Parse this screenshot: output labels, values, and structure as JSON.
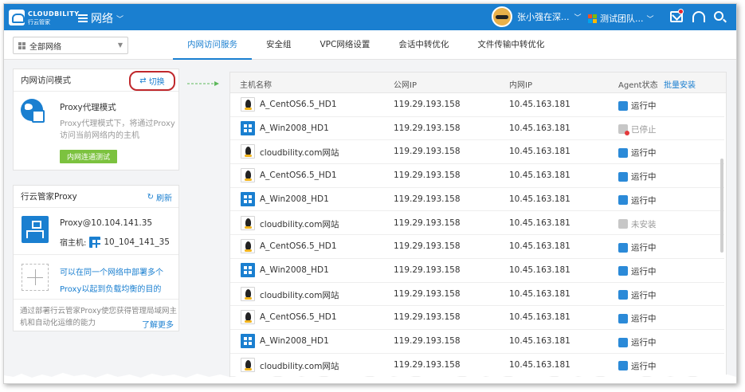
{
  "topbar": {
    "logo_text": "CLOUDBILITY",
    "logo_sub": "行云管家",
    "menu_title": "网络",
    "user_name": "张小强在深...",
    "team_name": "测试团队..."
  },
  "subnav": {
    "network_select": "全部网络",
    "tabs": [
      "内网访问服务",
      "安全组",
      "VPC网络设置",
      "会话中转优化",
      "文件传输中转优化"
    ]
  },
  "mode_panel": {
    "header": "内网访问模式",
    "switch_label": "切换",
    "mode_title": "Proxy代理模式",
    "mode_desc": "Proxy代理模式下，将通过Proxy访问当前网络内的主机",
    "test_button": "内网连通测试"
  },
  "proxy_panel": {
    "header": "行云管家Proxy",
    "refresh_label": "刷新",
    "proxy_name": "Proxy@10.104.141.35",
    "host_label": "宿主机:",
    "host_value": "10_104_141_35",
    "add_text": "可以在同一个网络中部署多个Proxy以起到负载均衡的目的",
    "footer_text": "通过部署行云管家Proxy使您获得管理局域网主机和自动化运维的能力",
    "learn_more": "了解更多"
  },
  "table": {
    "headers": {
      "host": "主机名称",
      "public_ip": "公网IP",
      "private_ip": "内网IP",
      "agent": "Agent状态",
      "bulk_install": "批量安装"
    },
    "rows": [
      {
        "os": "linux",
        "name": "A_CentOS6.5_HD1",
        "public_ip": "119.29.193.158",
        "private_ip": "10.45.163.181",
        "status": "运行中",
        "state": "running"
      },
      {
        "os": "windows",
        "name": "A_Win2008_HD1",
        "public_ip": "119.29.193.158",
        "private_ip": "10.45.163.181",
        "status": "已停止",
        "state": "stopped"
      },
      {
        "os": "linux",
        "name": "cloudbility.com网站",
        "public_ip": "119.29.193.158",
        "private_ip": "10.45.163.181",
        "status": "运行中",
        "state": "running"
      },
      {
        "os": "linux",
        "name": "A_CentOS6.5_HD1",
        "public_ip": "119.29.193.158",
        "private_ip": "10.45.163.181",
        "status": "运行中",
        "state": "running"
      },
      {
        "os": "windows",
        "name": "A_Win2008_HD1",
        "public_ip": "119.29.193.158",
        "private_ip": "10.45.163.181",
        "status": "运行中",
        "state": "running"
      },
      {
        "os": "linux",
        "name": "cloudbility.com网站",
        "public_ip": "119.29.193.158",
        "private_ip": "10.45.163.181",
        "status": "未安装",
        "state": "uninstalled"
      },
      {
        "os": "linux",
        "name": "A_CentOS6.5_HD1",
        "public_ip": "119.29.193.158",
        "private_ip": "10.45.163.181",
        "status": "运行中",
        "state": "running"
      },
      {
        "os": "windows",
        "name": "A_Win2008_HD1",
        "public_ip": "119.29.193.158",
        "private_ip": "10.45.163.181",
        "status": "运行中",
        "state": "running"
      },
      {
        "os": "linux",
        "name": "cloudbility.com网站",
        "public_ip": "119.29.193.158",
        "private_ip": "10.45.163.181",
        "status": "运行中",
        "state": "running"
      },
      {
        "os": "linux",
        "name": "A_CentOS6.5_HD1",
        "public_ip": "119.29.193.158",
        "private_ip": "10.45.163.181",
        "status": "运行中",
        "state": "running"
      },
      {
        "os": "windows",
        "name": "A_Win2008_HD1",
        "public_ip": "119.29.193.158",
        "private_ip": "10.45.163.181",
        "status": "运行中",
        "state": "running"
      },
      {
        "os": "linux",
        "name": "cloudbility.com网站",
        "public_ip": "119.29.193.158",
        "private_ip": "10.45.163.181",
        "status": "运行中",
        "state": "running"
      }
    ]
  },
  "colors": {
    "brand_blue": "#1a7fd0",
    "highlight_red": "#c0282c",
    "test_green": "#7cc23f",
    "stopped_red": "#e4393c"
  }
}
